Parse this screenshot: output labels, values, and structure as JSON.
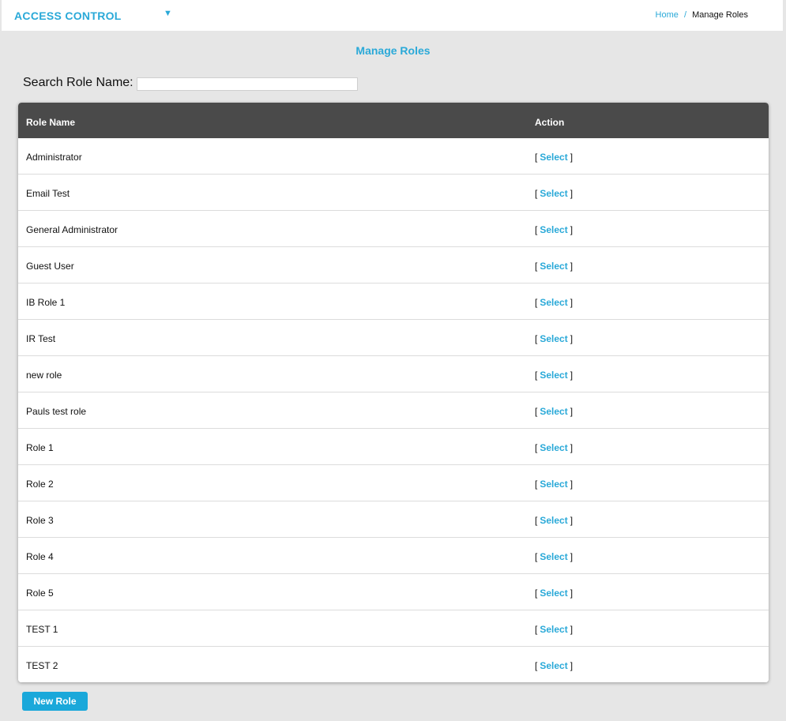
{
  "header": {
    "app_title": "ACCESS CONTROL",
    "caret": "▼",
    "breadcrumb": {
      "home": "Home",
      "separator": "/",
      "current": "Manage Roles"
    }
  },
  "page": {
    "title": "Manage Roles",
    "search_label": "Search Role Name:",
    "search_value": "",
    "search_placeholder": ""
  },
  "table": {
    "columns": {
      "role_name": "Role Name",
      "action": "Action"
    },
    "action_open": "[",
    "action_label": "Select",
    "action_close": "]",
    "rows": [
      {
        "name": "Administrator"
      },
      {
        "name": "Email Test"
      },
      {
        "name": "General Administrator"
      },
      {
        "name": "Guest User"
      },
      {
        "name": "IB Role 1"
      },
      {
        "name": "IR Test"
      },
      {
        "name": "new role"
      },
      {
        "name": "Pauls test role"
      },
      {
        "name": "Role 1"
      },
      {
        "name": "Role 2"
      },
      {
        "name": "Role 3"
      },
      {
        "name": "Role 4"
      },
      {
        "name": "Role 5"
      },
      {
        "name": "TEST 1"
      },
      {
        "name": "TEST 2"
      }
    ]
  },
  "actions": {
    "new_role_label": "New Role"
  },
  "colors": {
    "accent": "#2aa9d8",
    "header_bg": "#4a4a4a",
    "page_bg": "#e6e6e6",
    "button_bg": "#1aa8da"
  }
}
